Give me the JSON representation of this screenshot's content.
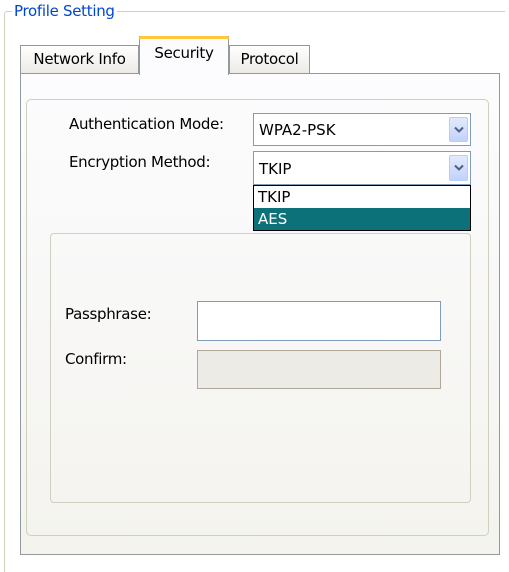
{
  "group": {
    "title": "Profile Setting"
  },
  "tabs": [
    {
      "label": "Network Info",
      "active": false
    },
    {
      "label": "Security",
      "active": true
    },
    {
      "label": "Protocol",
      "active": false
    }
  ],
  "security": {
    "authentication_mode_label": "Authentication Mode:",
    "authentication_mode_value": "WPA2-PSK",
    "encryption_method_label": "Encryption Method:",
    "encryption_method_value": "TKIP",
    "encryption_options": [
      "TKIP",
      "AES"
    ],
    "highlighted_option": "AES",
    "passphrase_label": "Passphrase:",
    "passphrase_value": "",
    "confirm_label": "Confirm:",
    "confirm_value": ""
  },
  "icons": {
    "combo_arrow": "chevron-down-icon"
  },
  "colors": {
    "group_title": "#0046d5",
    "active_tab_highlight": "#ffc83c",
    "dropdown_selection": "#0d7179",
    "border": "#7f9db9"
  }
}
